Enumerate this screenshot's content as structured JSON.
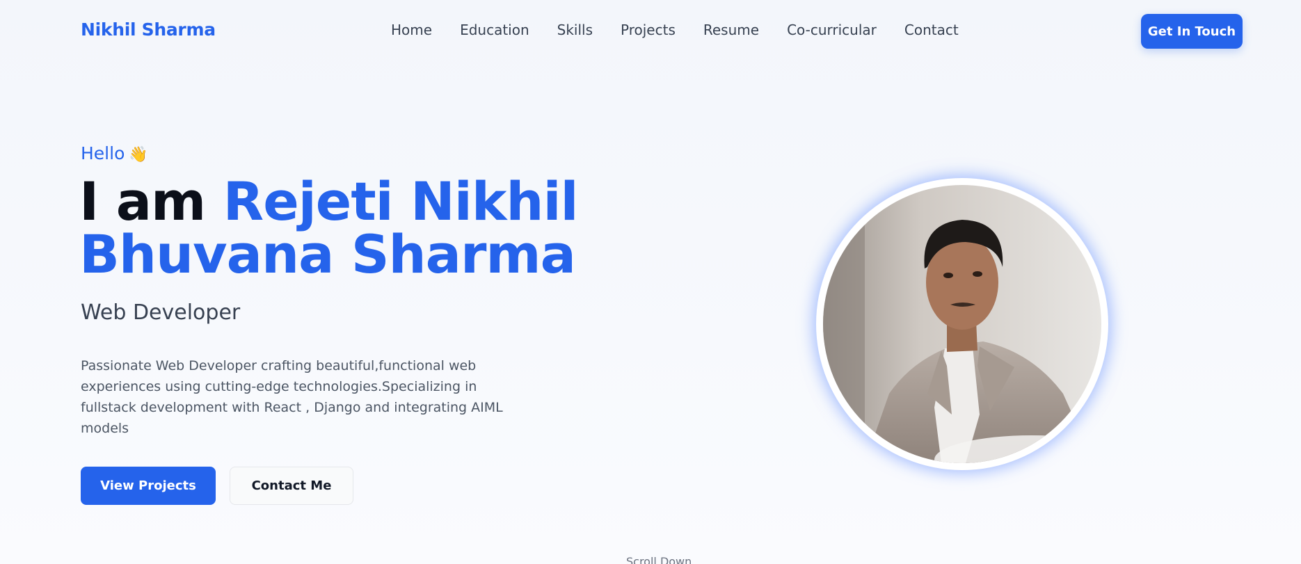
{
  "nav": {
    "brand": "Nikhil Sharma",
    "links": [
      "Home",
      "Education",
      "Skills",
      "Projects",
      "Resume",
      "Co-curricular",
      "Contact"
    ],
    "cta": "Get In Touch"
  },
  "hero": {
    "greeting": "Hello",
    "greeting_icon": "waving-hand-icon",
    "headline_prefix": "I am ",
    "headline_name_line1": "Rejeti Nikhil",
    "headline_name_line2": "Bhuvana Sharma",
    "role": "Web Developer",
    "description": "Passionate Web Developer crafting beautiful,functional web experiences using cutting-edge technologies.Specializing in fullstack development with React , Django and integrating AIML models",
    "primary_button": "View Projects",
    "secondary_button": "Contact Me",
    "scroll_hint": "Scroll Down"
  },
  "colors": {
    "accent": "#2563eb",
    "heading": "#0b0f19",
    "body_text": "#4b5563",
    "background": "#f5f7fc"
  }
}
